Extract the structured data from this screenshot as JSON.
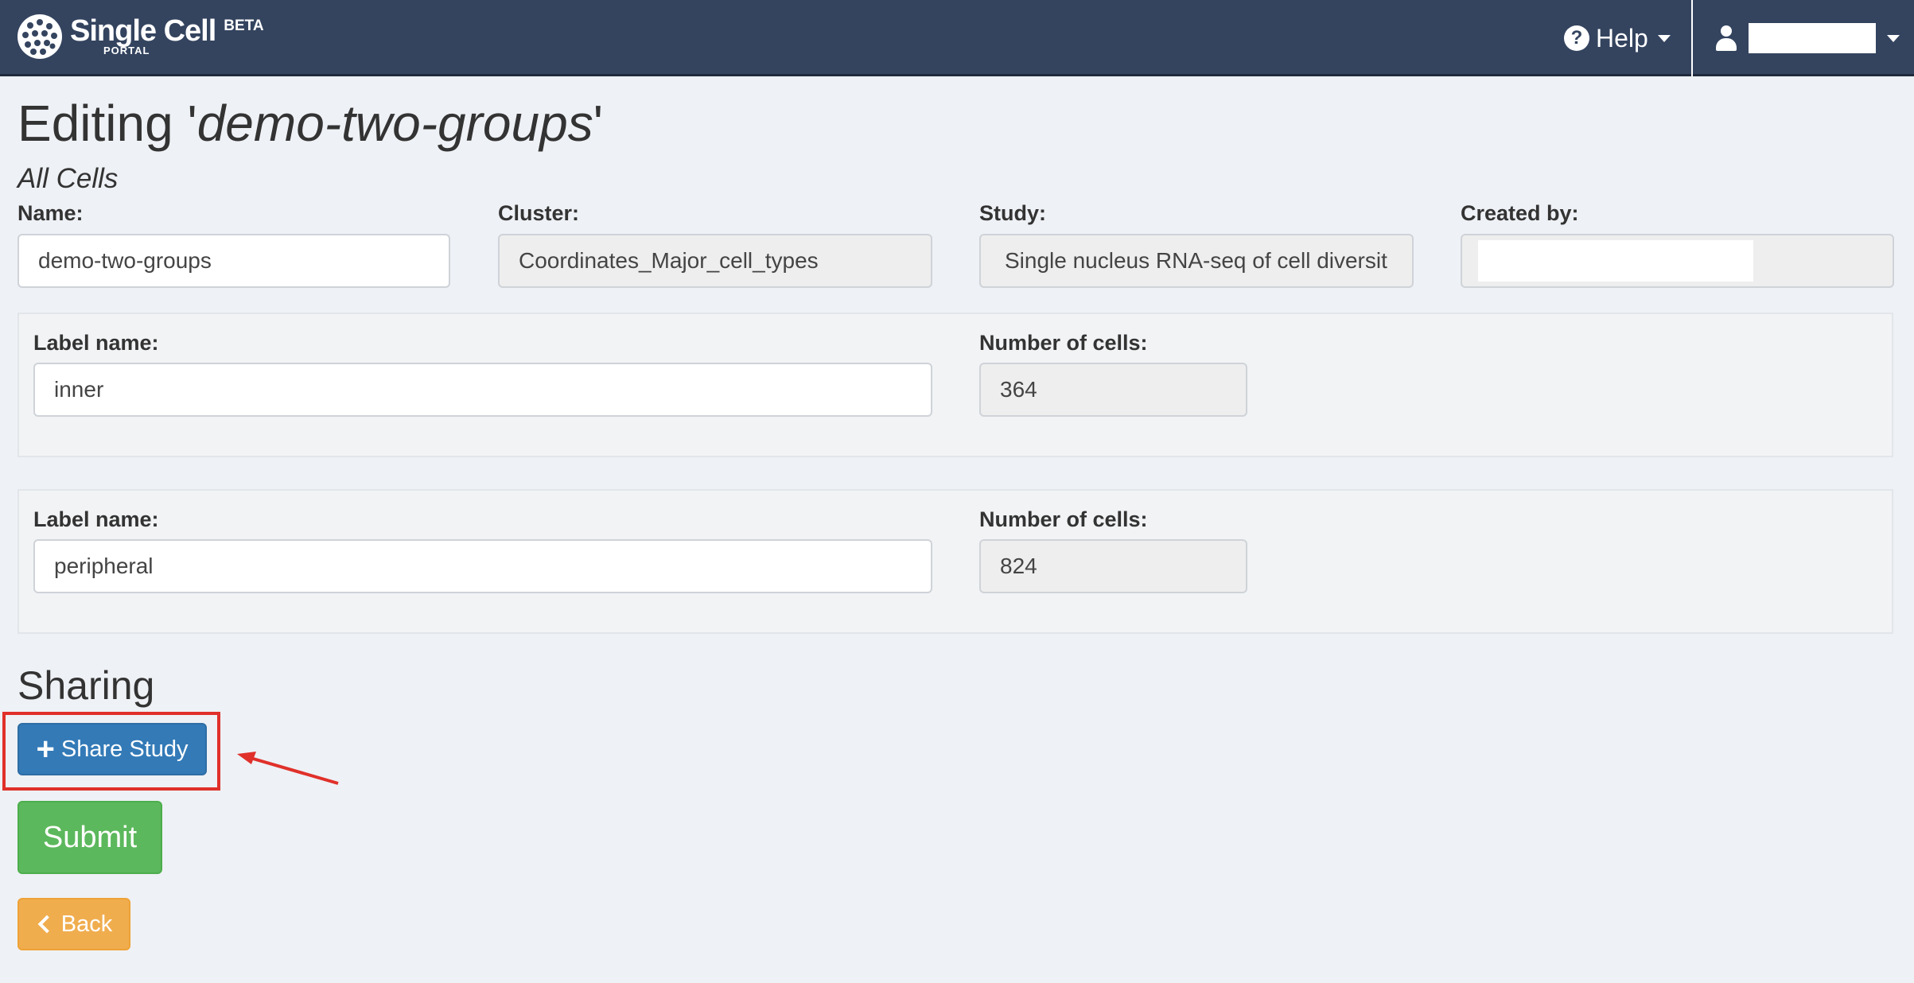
{
  "navbar": {
    "brand_name": "Single Cell",
    "brand_sub": "PORTAL",
    "brand_badge": "BETA",
    "help_label": "Help",
    "colors": {
      "background": "#34445f"
    }
  },
  "page": {
    "title_prefix": "Editing '",
    "title_name": "demo-two-groups",
    "title_suffix": "'",
    "subtitle": "All Cells"
  },
  "form": {
    "name_label": "Name:",
    "name_value": "demo-two-groups",
    "cluster_label": "Cluster:",
    "cluster_value": "Coordinates_Major_cell_types",
    "study_label": "Study:",
    "study_value": "Single nucleus RNA-seq of cell diversit",
    "created_by_label": "Created by:",
    "created_by_value": ""
  },
  "labels": [
    {
      "label_name_label": "Label name:",
      "label_name_value": "inner",
      "cells_label": "Number of cells:",
      "cells_value": "364"
    },
    {
      "label_name_label": "Label name:",
      "label_name_value": "peripheral",
      "cells_label": "Number of cells:",
      "cells_value": "824"
    }
  ],
  "sharing": {
    "title": "Sharing",
    "share_button": "Share Study"
  },
  "actions": {
    "submit": "Submit",
    "back": "Back"
  },
  "colors": {
    "primary": "#337ab7",
    "success": "#5cb85c",
    "warning": "#f0ad4e",
    "annotation": "#e0302a"
  },
  "icons": [
    "logo-icon",
    "help-icon",
    "user-icon",
    "plus-icon",
    "chevron-left-icon"
  ]
}
